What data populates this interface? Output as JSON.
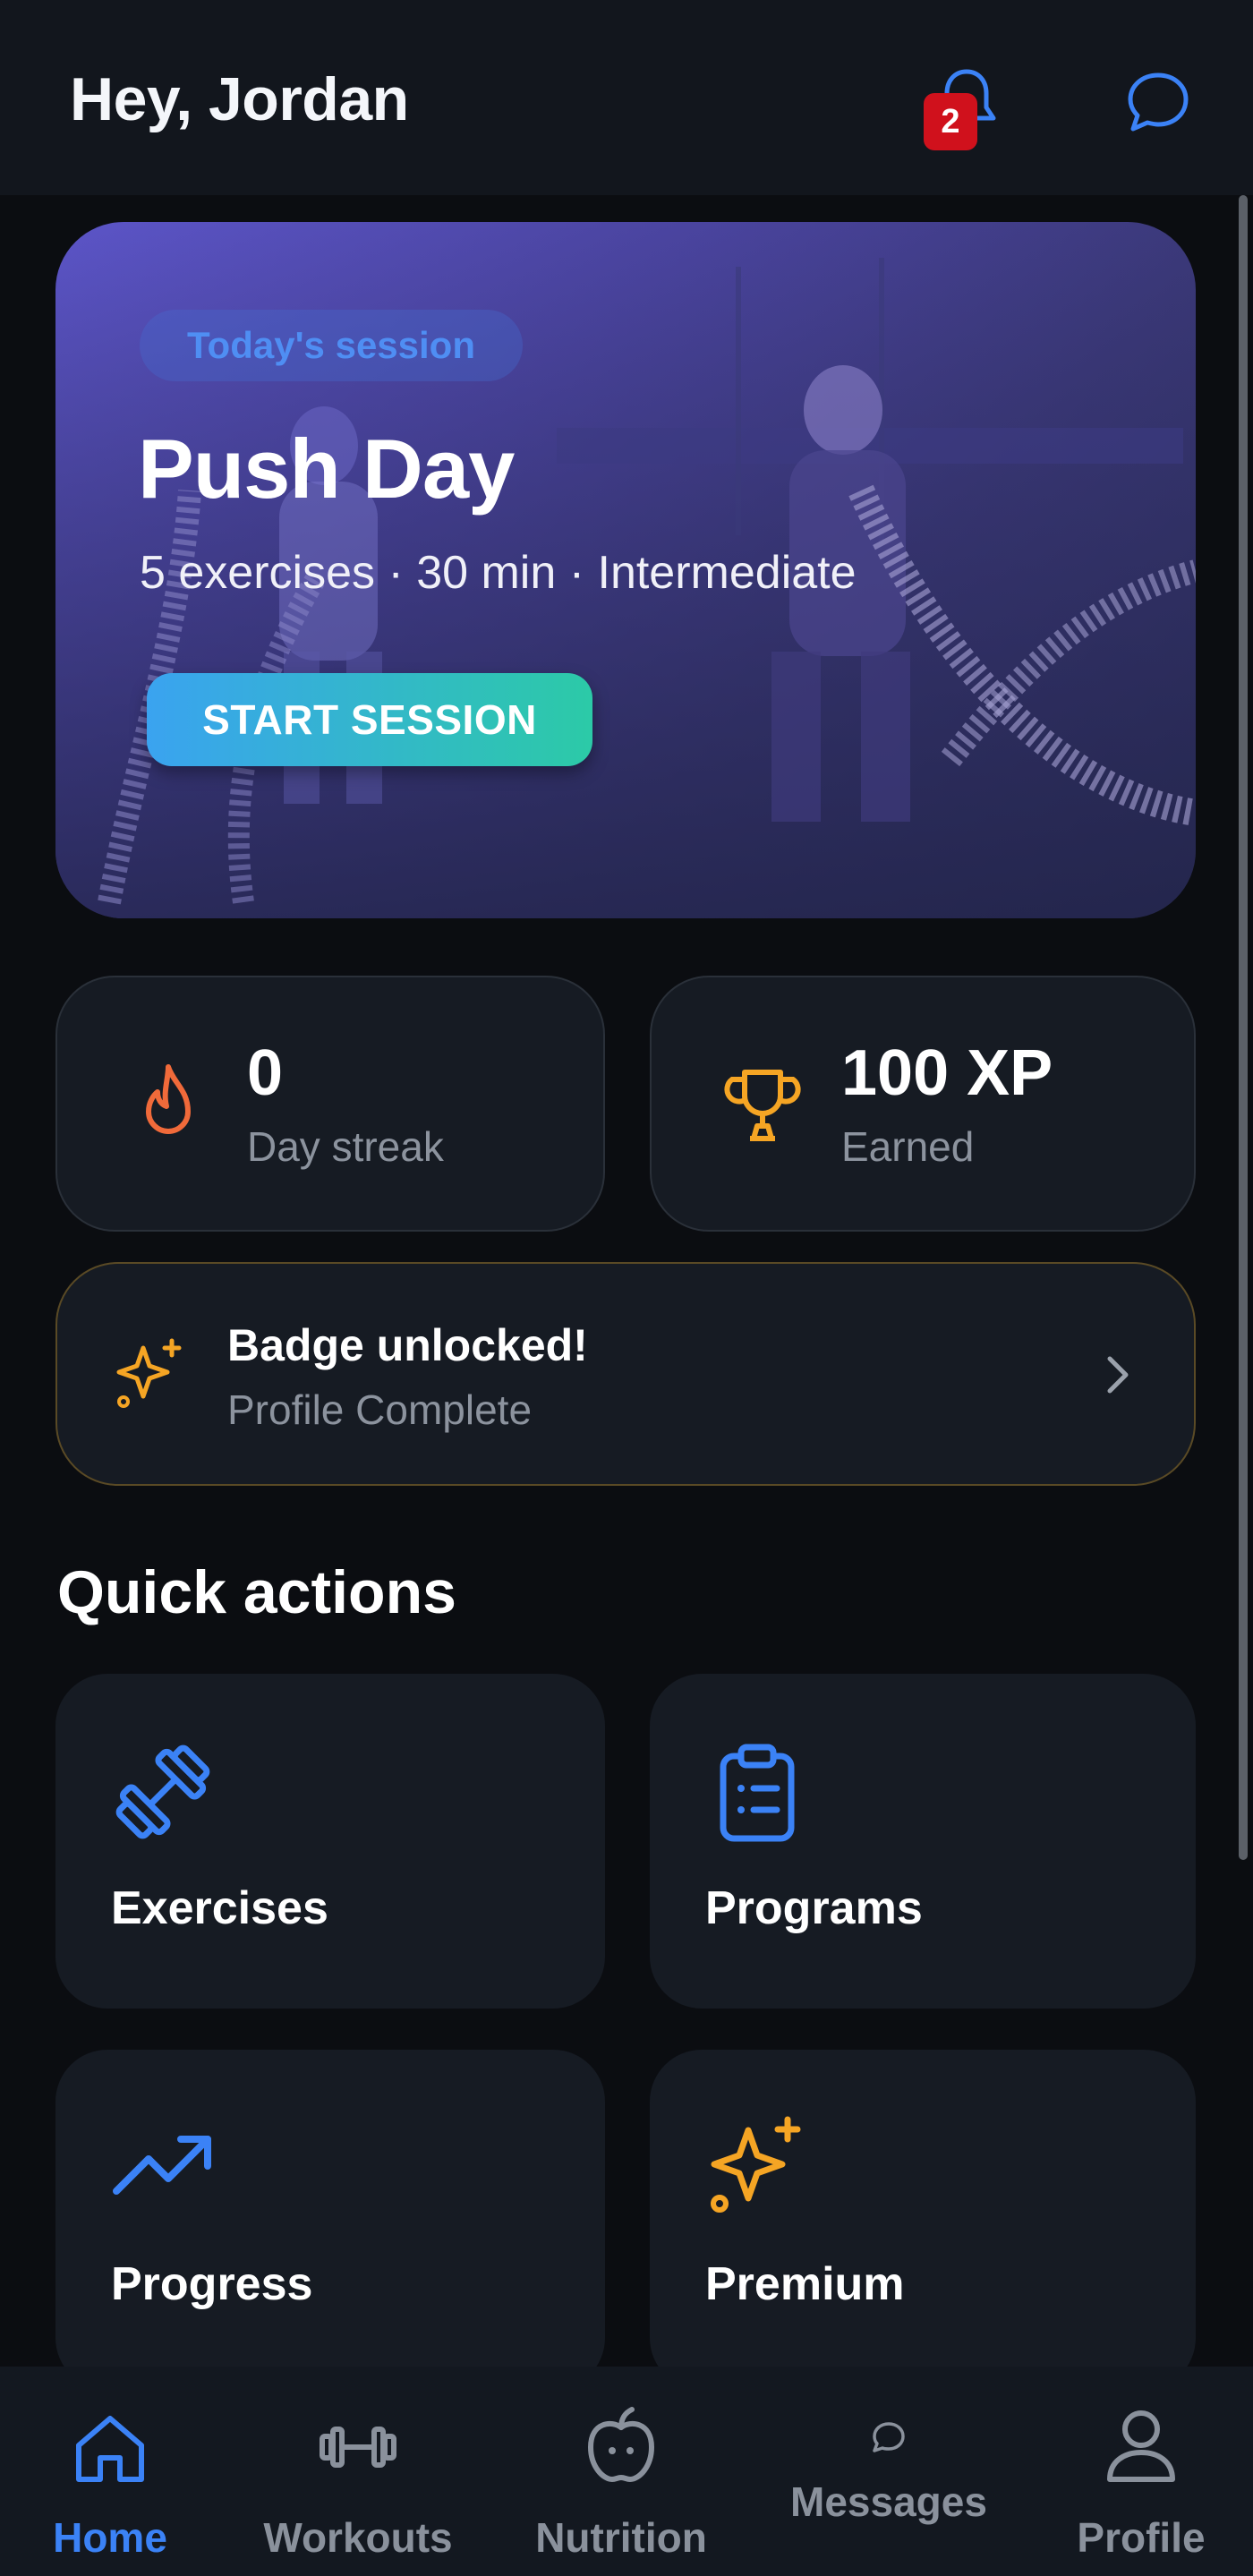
{
  "header": {
    "greeting": "Hey, Jordan",
    "notification_count": "2",
    "bell_icon": "bell-icon",
    "chat_icon": "message-circle-icon"
  },
  "hero": {
    "pill": "Today's session",
    "title": "Push Day",
    "subtitle": "5 exercises · 30 min · Intermediate",
    "cta": "START SESSION"
  },
  "stats": [
    {
      "value": "0",
      "label": "Day streak",
      "icon": "flame-icon",
      "color": "#f06a3a"
    },
    {
      "value": "100 XP",
      "label": "Earned",
      "icon": "trophy-icon",
      "color": "#f5a524"
    }
  ],
  "badge_banner": {
    "title": "Badge unlocked!",
    "subtitle": "Profile Complete",
    "icon": "sparkles-icon"
  },
  "quick_actions": {
    "title": "Quick actions",
    "items": [
      {
        "label": "Exercises",
        "icon": "dumbbell-icon"
      },
      {
        "label": "Programs",
        "icon": "clipboard-list-icon"
      },
      {
        "label": "Progress",
        "icon": "trending-up-icon"
      },
      {
        "label": "Premium",
        "icon": "sparkles-icon"
      }
    ]
  },
  "bottom_nav": {
    "items": [
      {
        "label": "Home",
        "icon": "home-icon",
        "active": true
      },
      {
        "label": "Workouts",
        "icon": "dumbbell-icon",
        "active": false
      },
      {
        "label": "Nutrition",
        "icon": "apple-icon",
        "active": false
      },
      {
        "label": "Messages",
        "icon": "message-circle-icon",
        "active": false
      },
      {
        "label": "Profile",
        "icon": "user-icon",
        "active": false
      }
    ]
  },
  "colors": {
    "accent_blue": "#3b82f6",
    "accent_orange": "#f5a524",
    "flame": "#f06a3a",
    "cta_start": "#3aa3f0",
    "cta_end": "#2ccaa7",
    "notification_red": "#d0111c"
  }
}
